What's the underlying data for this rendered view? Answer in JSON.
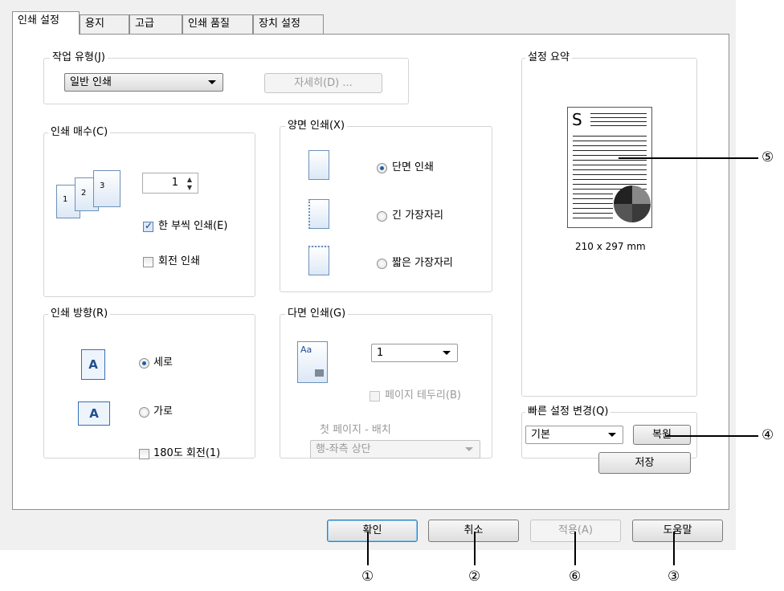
{
  "tabs": [
    {
      "label": "인쇄 설정",
      "active": true
    },
    {
      "label": "용지",
      "active": false
    },
    {
      "label": "고급",
      "active": false
    },
    {
      "label": "인쇄 품질",
      "active": false
    },
    {
      "label": "장치 설정",
      "active": false
    }
  ],
  "job_type": {
    "legend": "작업 유형(J)",
    "selected": "일반 인쇄",
    "details_button": "자세히(D) ..."
  },
  "copies": {
    "legend": "인쇄 매수(C)",
    "value": "1",
    "illustration_numbers": [
      "1",
      "2",
      "3"
    ],
    "collate_label": "한 부씩 인쇄(E)",
    "collate_checked": true,
    "rotate_label": "회전 인쇄",
    "rotate_checked": false
  },
  "orientation": {
    "legend": "인쇄 방향(R)",
    "portrait_label": "세로",
    "landscape_label": "가로",
    "rotate180_label": "180도 회전(1)",
    "icon_letter": "A",
    "selected": "portrait"
  },
  "duplex": {
    "legend": "양면 인쇄(X)",
    "options": [
      {
        "label": "단면 인쇄",
        "selected": true
      },
      {
        "label": "긴 가장자리",
        "selected": false
      },
      {
        "label": "짧은 가장자리",
        "selected": false
      }
    ]
  },
  "nup": {
    "legend": "다면 인쇄(G)",
    "value": "1",
    "icon_text": "Aa",
    "page_border_label": "페이지 테두리(B)",
    "first_page_label": "첫 페이지 - 배치",
    "layout_value": "행-좌측 상단"
  },
  "summary": {
    "legend": "설정 요약",
    "preview_letter": "S",
    "paper_size": "210 x 297 mm"
  },
  "quick_settings": {
    "legend": "빠른 설정 변경(Q)",
    "selected": "기본",
    "restore_button": "복원",
    "save_button": "저장"
  },
  "footer": {
    "ok": "확인",
    "cancel": "취소",
    "apply": "적용(A)",
    "help": "도움말"
  },
  "callouts": {
    "ok": "①",
    "cancel": "②",
    "help": "③",
    "restore": "④",
    "preview": "⑤",
    "apply": "⑥"
  },
  "colors": {
    "dialog_bg": "#f0f0f0",
    "panel_bg": "#ffffff",
    "accent_blue": "#1f5fa8",
    "default_button_border": "#3c7fb1"
  }
}
